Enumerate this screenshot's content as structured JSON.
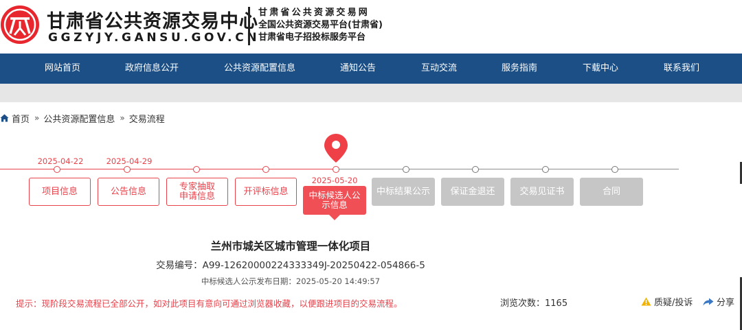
{
  "header": {
    "site_title": "甘肃省公共资源交易中心",
    "site_domain": "GGZYJY.GANSU.GOV.CN",
    "lines": [
      "甘肃省公共资源交易网",
      "全国公共资源交易平台(甘肃省)",
      "甘肃省电子招投标服务平台"
    ]
  },
  "nav": {
    "items": [
      "网站首页",
      "政府信息公开",
      "公共资源配置信息",
      "通知公告",
      "互动交流",
      "服务指南",
      "下载中心",
      "联系我们"
    ]
  },
  "breadcrumb": {
    "items": [
      "首页",
      "公共资源配置信息",
      "交易流程"
    ]
  },
  "timeline": {
    "steps": [
      {
        "label": "项目信息",
        "status": "done",
        "date": "2025-04-22"
      },
      {
        "label": "公告信息",
        "status": "done",
        "date": "2025-04-29"
      },
      {
        "label": "专家抽取申请信息",
        "status": "done",
        "date": ""
      },
      {
        "label": "开评标信息",
        "status": "done",
        "date": ""
      },
      {
        "label": "中标候选人公示信息",
        "status": "current",
        "date": "2025-05-20"
      },
      {
        "label": "中标结果公示",
        "status": "pending",
        "date": ""
      },
      {
        "label": "保证金退还",
        "status": "pending",
        "date": ""
      },
      {
        "label": "交易见证书",
        "status": "pending",
        "date": ""
      },
      {
        "label": "合同",
        "status": "pending",
        "date": ""
      }
    ]
  },
  "project": {
    "title": "兰州市城关区城市管理一体化项目",
    "number_label": "交易编号：",
    "number": "A99-12620000224333349J-20250422-054866-5",
    "publish_label": "中标候选人公示发布日期：",
    "publish_date": "2025-05-20 14:49:57"
  },
  "footer": {
    "notice": "提示：现阶段交易流程已全部公开，如对此项目有意向可通过浏览器收藏，以便跟进项目的交易流程。",
    "views_label": "浏览次数：",
    "views": "1165",
    "question_label": "质疑/投诉",
    "share_label": "分享"
  },
  "colors": {
    "brand_red": "#e8424b",
    "nav_blue": "#1b4f86",
    "pending_gray": "#c6c6c6",
    "accent_yellow": "#f0b400",
    "share_blue": "#3a78c4"
  },
  "icons": {
    "logo": "gansu-emblem-icon",
    "home": "home-icon",
    "separator": "double-chevron-icon",
    "current": "map-pin-icon",
    "question": "warning-icon",
    "share": "share-arrow-icon"
  }
}
